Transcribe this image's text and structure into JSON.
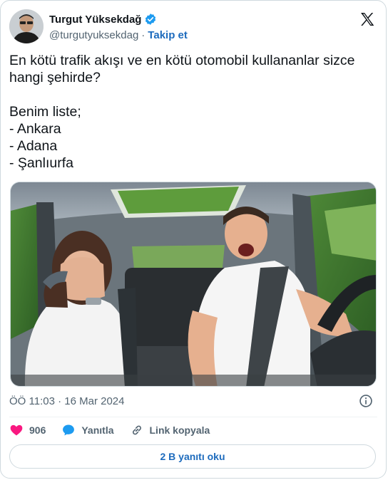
{
  "author": {
    "name": "Turgut Yüksekdağ",
    "handle": "@turgutyuksekdag",
    "separator": "·",
    "follow_label": "Takip et"
  },
  "tweet": {
    "text": "En kötü trafik akışı ve en kötü otomobil kullananlar sizce hangi şehirde?\n\nBenim liste;\n- Ankara\n- Adana\n- Şanlıurfa",
    "timestamp": "ÖÖ 11:03 · 16 Mar 2024"
  },
  "actions": {
    "like_count": "906",
    "reply_label": "Yanıtla",
    "copy_link_label": "Link kopyala"
  },
  "read_replies_label": "2 B yanıtı oku",
  "colors": {
    "accent": "#1d6bbd",
    "like": "#f91880",
    "verified": "#1d9bf0"
  },
  "icons": [
    "verified-badge-icon",
    "x-logo-icon",
    "info-icon",
    "heart-icon",
    "reply-bubble-icon",
    "link-icon"
  ]
}
